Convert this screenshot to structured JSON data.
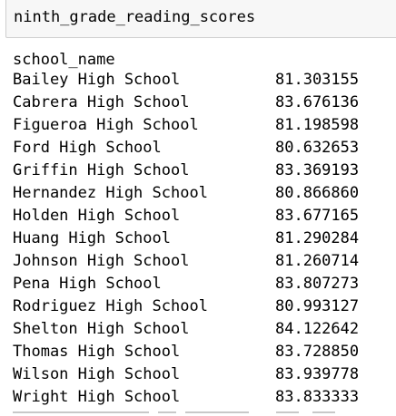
{
  "input_cell": {
    "code": "ninth_grade_reading_scores"
  },
  "output": {
    "index_name": "school_name",
    "rows": [
      {
        "school": "Bailey High School",
        "value": "81.303155"
      },
      {
        "school": "Cabrera High School",
        "value": "83.676136"
      },
      {
        "school": "Figueroa High School",
        "value": "81.198598"
      },
      {
        "school": "Ford High School",
        "value": "80.632653"
      },
      {
        "school": "Griffin High School",
        "value": "83.369193"
      },
      {
        "school": "Hernandez High School",
        "value": "80.866860"
      },
      {
        "school": "Holden High School",
        "value": "83.677165"
      },
      {
        "school": "Huang High School",
        "value": "81.290284"
      },
      {
        "school": "Johnson High School",
        "value": "81.260714"
      },
      {
        "school": "Pena High School",
        "value": "83.807273"
      },
      {
        "school": "Rodriguez High School",
        "value": "80.993127"
      },
      {
        "school": "Shelton High School",
        "value": "84.122642"
      },
      {
        "school": "Thomas High School",
        "value": "83.728850"
      },
      {
        "school": "Wilson High School",
        "value": "83.939778"
      },
      {
        "school": "Wright High School",
        "value": "83.833333"
      }
    ]
  },
  "colors": {
    "input_background": "#f7f7f7",
    "input_border": "#cfcfcf",
    "text": "#000000"
  }
}
